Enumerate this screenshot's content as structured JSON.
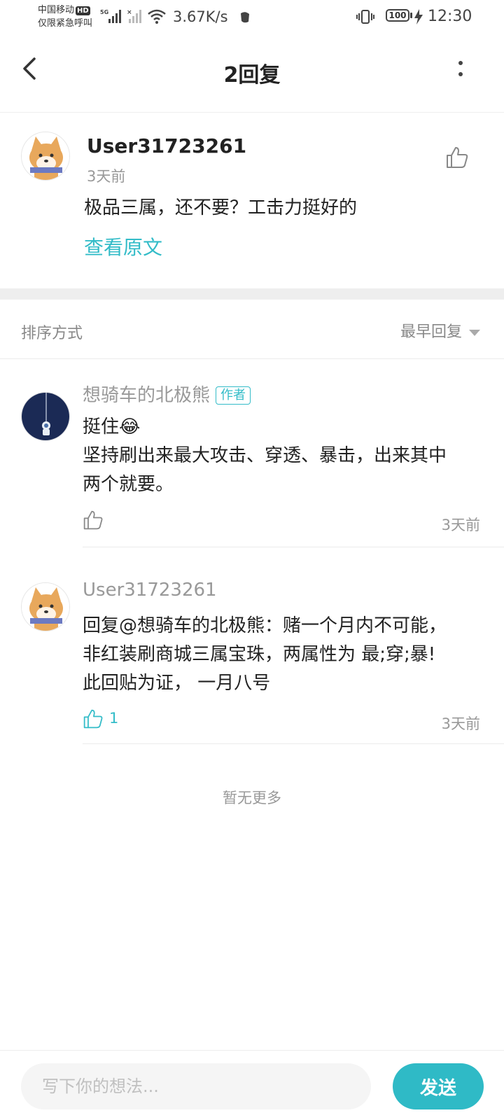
{
  "status_bar": {
    "carrier_line1": "中国移动",
    "carrier_hd": "HD",
    "carrier_line2": "仅限紧急呼叫",
    "network_type": "5G",
    "net_speed": "3.67K/s",
    "battery": "100",
    "time": "12:30"
  },
  "header": {
    "title": "2回复"
  },
  "original_comment": {
    "username": "User31723261",
    "time": "3天前",
    "text": "极品三属，还不要？工击力挺好的",
    "view_original_label": "查看原文"
  },
  "sort": {
    "label": "排序方式",
    "selected": "最早回复"
  },
  "replies": [
    {
      "username": "想骑车的北极熊",
      "badge": "作者",
      "line1": "挺住😂",
      "line2": "坚持刷出来最大攻击、穿透、暴击，出来其中",
      "line3": "两个就要。",
      "like_count": "",
      "time": "3天前"
    },
    {
      "username": "User31723261",
      "badge": "",
      "line1": "回复@想骑车的北极熊：赌一个月内不可能，",
      "line2": "非红装刷商城三属宝珠，两属性为 最;穿;暴!",
      "line3": "此回贴为证， 一月八号",
      "like_count": "1",
      "time": "3天前"
    }
  ],
  "no_more_text": "暂无更多",
  "composer": {
    "placeholder": "写下你的想法...",
    "send_label": "发送"
  },
  "colors": {
    "accent": "#33bcc8",
    "send_button": "#2fbac6"
  }
}
